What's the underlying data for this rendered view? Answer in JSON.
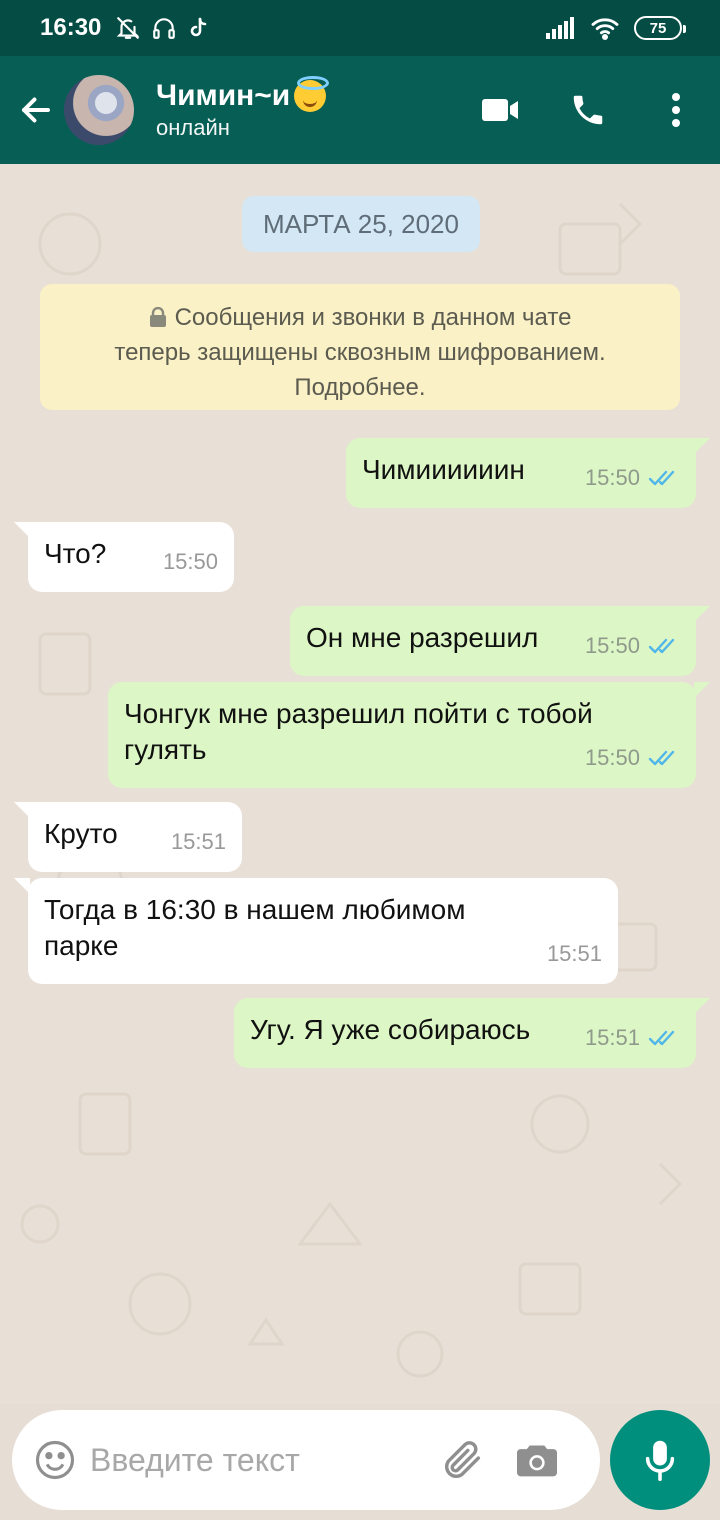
{
  "status_bar": {
    "time": "16:30",
    "battery": "75",
    "icons": [
      "bell-off-icon",
      "headphones-icon",
      "tiktok-icon",
      "signal-icon",
      "wifi-icon",
      "battery-icon"
    ]
  },
  "header": {
    "contact_name": "Чимин~и",
    "contact_emoji": "smiling-face-with-halo-emoji",
    "contact_status": "онлайн",
    "icons": [
      "back-arrow-icon",
      "video-call-icon",
      "phone-icon",
      "more-vert-icon"
    ]
  },
  "chat": {
    "date_label": "МАРТА 25, 2020",
    "encryption_notice": {
      "line1": "Сообщения и звонки в данном чате",
      "line2": "теперь защищены сквозным шифрованием.",
      "line3": "Подробнее."
    },
    "messages": [
      {
        "direction": "out",
        "text": "Чимиииииин",
        "time": "15:50",
        "status": "read"
      },
      {
        "direction": "in",
        "text": "Что?",
        "time": "15:50"
      },
      {
        "direction": "out",
        "text": "Он мне разрешил",
        "time": "15:50",
        "status": "read"
      },
      {
        "direction": "out",
        "text_line1": "Чонгук мне разрешил пойти с тобой",
        "text_line2": "гулять",
        "time": "15:50",
        "status": "read"
      },
      {
        "direction": "in",
        "text": "Круто",
        "time": "15:51"
      },
      {
        "direction": "in",
        "text_line1": "Тогда в 16:30 в нашем любимом",
        "text_line2": "парке",
        "time": "15:51"
      },
      {
        "direction": "out",
        "text": "Угу. Я уже собираюсь",
        "time": "15:51",
        "status": "read"
      }
    ]
  },
  "composer": {
    "placeholder": "Введите текст",
    "value": "",
    "icons": [
      "emoji-icon",
      "paperclip-icon",
      "camera-icon",
      "mic-icon"
    ]
  },
  "colors": {
    "header": "#075e54",
    "status_bar": "#054d44",
    "outgoing_bubble": "#dcf7c5",
    "incoming_bubble": "#ffffff",
    "read_ticks": "#4fb6ec",
    "mic_button": "#008f7c",
    "chat_background": "#e8dfd6"
  }
}
